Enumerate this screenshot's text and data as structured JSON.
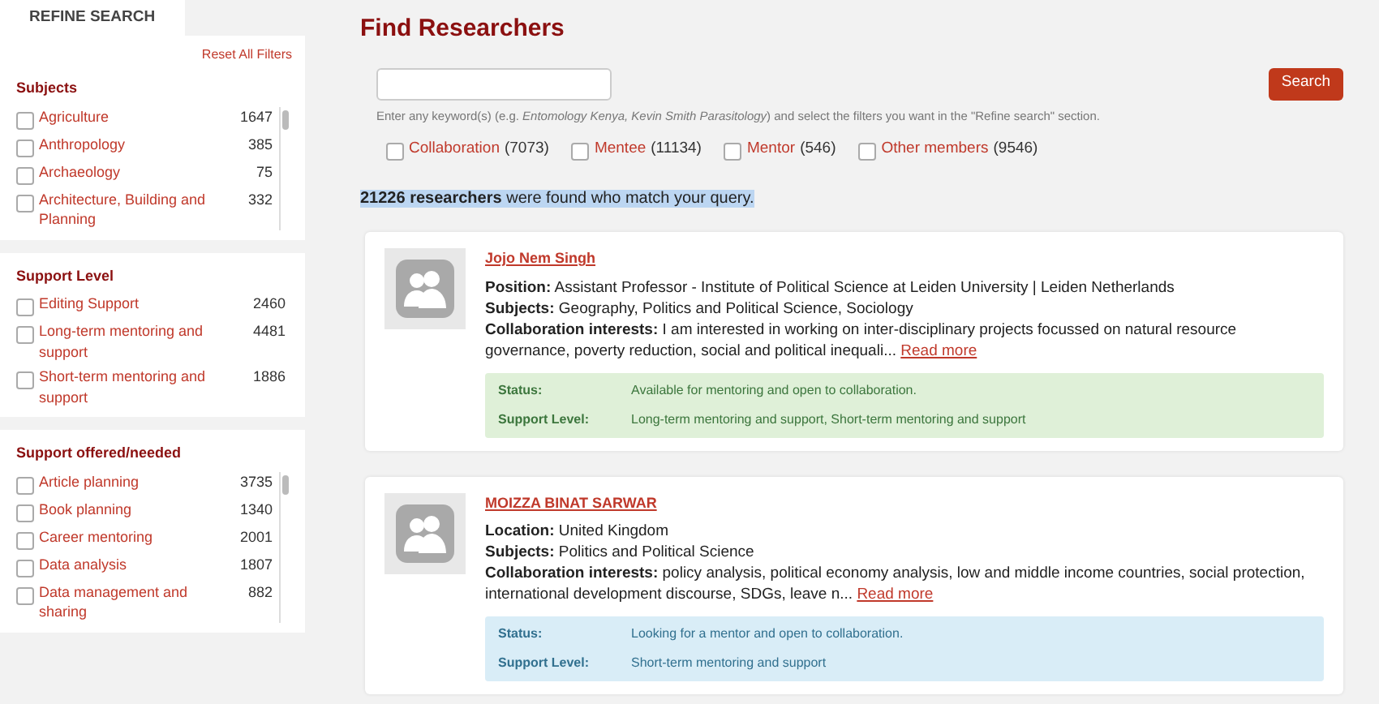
{
  "sidebar": {
    "tab": "REFINE SEARCH",
    "reset": "Reset All Filters",
    "sections": [
      {
        "title": "Subjects",
        "scroll": true,
        "items": [
          {
            "label": "Agriculture",
            "count": "1647",
            "checked": false
          },
          {
            "label": "Anthropology",
            "count": "385",
            "checked": false
          },
          {
            "label": "Archaeology",
            "count": "75",
            "checked": false
          },
          {
            "label": "Architecture, Building and Planning",
            "count": "332",
            "checked": false
          }
        ]
      },
      {
        "title": "Support Level",
        "scroll": false,
        "items": [
          {
            "label": "Editing Support",
            "count": "2460",
            "checked": false
          },
          {
            "label": "Long-term mentoring and support",
            "count": "4481",
            "checked": false
          },
          {
            "label": "Short-term mentoring and support",
            "count": "1886",
            "checked": false
          }
        ]
      },
      {
        "title": "Support offered/needed",
        "scroll": true,
        "items": [
          {
            "label": "Article planning",
            "count": "3735",
            "checked": false
          },
          {
            "label": "Book planning",
            "count": "1340",
            "checked": false
          },
          {
            "label": "Career mentoring",
            "count": "2001",
            "checked": false
          },
          {
            "label": "Data analysis",
            "count": "1807",
            "checked": false
          },
          {
            "label": "Data management and sharing",
            "count": "882",
            "checked": false
          }
        ]
      }
    ]
  },
  "main": {
    "title": "Find Researchers",
    "search": {
      "button": "Search"
    },
    "hint": "Enter any keyword(s) (e.g. *Entomology Kenya, Kevin Smith Parasitology*) and select the filters you want in the \"Refine search\" section.",
    "roles": [
      {
        "label": "Collaboration",
        "count": "(7073)",
        "checked": false
      },
      {
        "label": "Mentee",
        "count": "(11134)",
        "checked": false
      },
      {
        "label": "Mentor",
        "count": "(546)",
        "checked": false
      },
      {
        "label": "Other members",
        "count": "(9546)",
        "checked": false
      }
    ],
    "result_summary": "**21226 researchers** were found who match your query.",
    "results": [
      {
        "name": "Jojo Nem Singh",
        "kind": "available",
        "read_more": "Read more",
        "fields": [
          {
            "label": "Position:",
            "value": "Assistant Professor - Institute of Political Science at Leiden University | Leiden Netherlands"
          },
          {
            "label": "Subjects:",
            "value": "Geography, Politics and Political Science, Sociology"
          },
          {
            "label": "Collaboration interests:",
            "value": "I am interested in working on inter-disciplinary projects focussed on natural resource governance, poverty reduction, social and political inequali..."
          }
        ],
        "status": [
          {
            "label": "Status:",
            "value": "Available for mentoring and open to collaboration."
          },
          {
            "label": "Support Level:",
            "value": "Long-term mentoring and support, Short-term mentoring and support"
          }
        ]
      },
      {
        "name": "MOIZZA BINAT SARWAR",
        "kind": "looking",
        "read_more": "Read more",
        "fields": [
          {
            "label": "Location:",
            "value": "United Kingdom"
          },
          {
            "label": "Subjects:",
            "value": "Politics and Political Science"
          },
          {
            "label": "Collaboration interests:",
            "value": "policy analysis, political economy analysis, low and middle income countries, social protection, international development discourse, SDGs, leave n..."
          }
        ],
        "status": [
          {
            "label": "Status:",
            "value": "Looking for a mentor and open to collaboration."
          },
          {
            "label": "Support Level:",
            "value": "Short-term mentoring and support"
          }
        ]
      }
    ]
  }
}
